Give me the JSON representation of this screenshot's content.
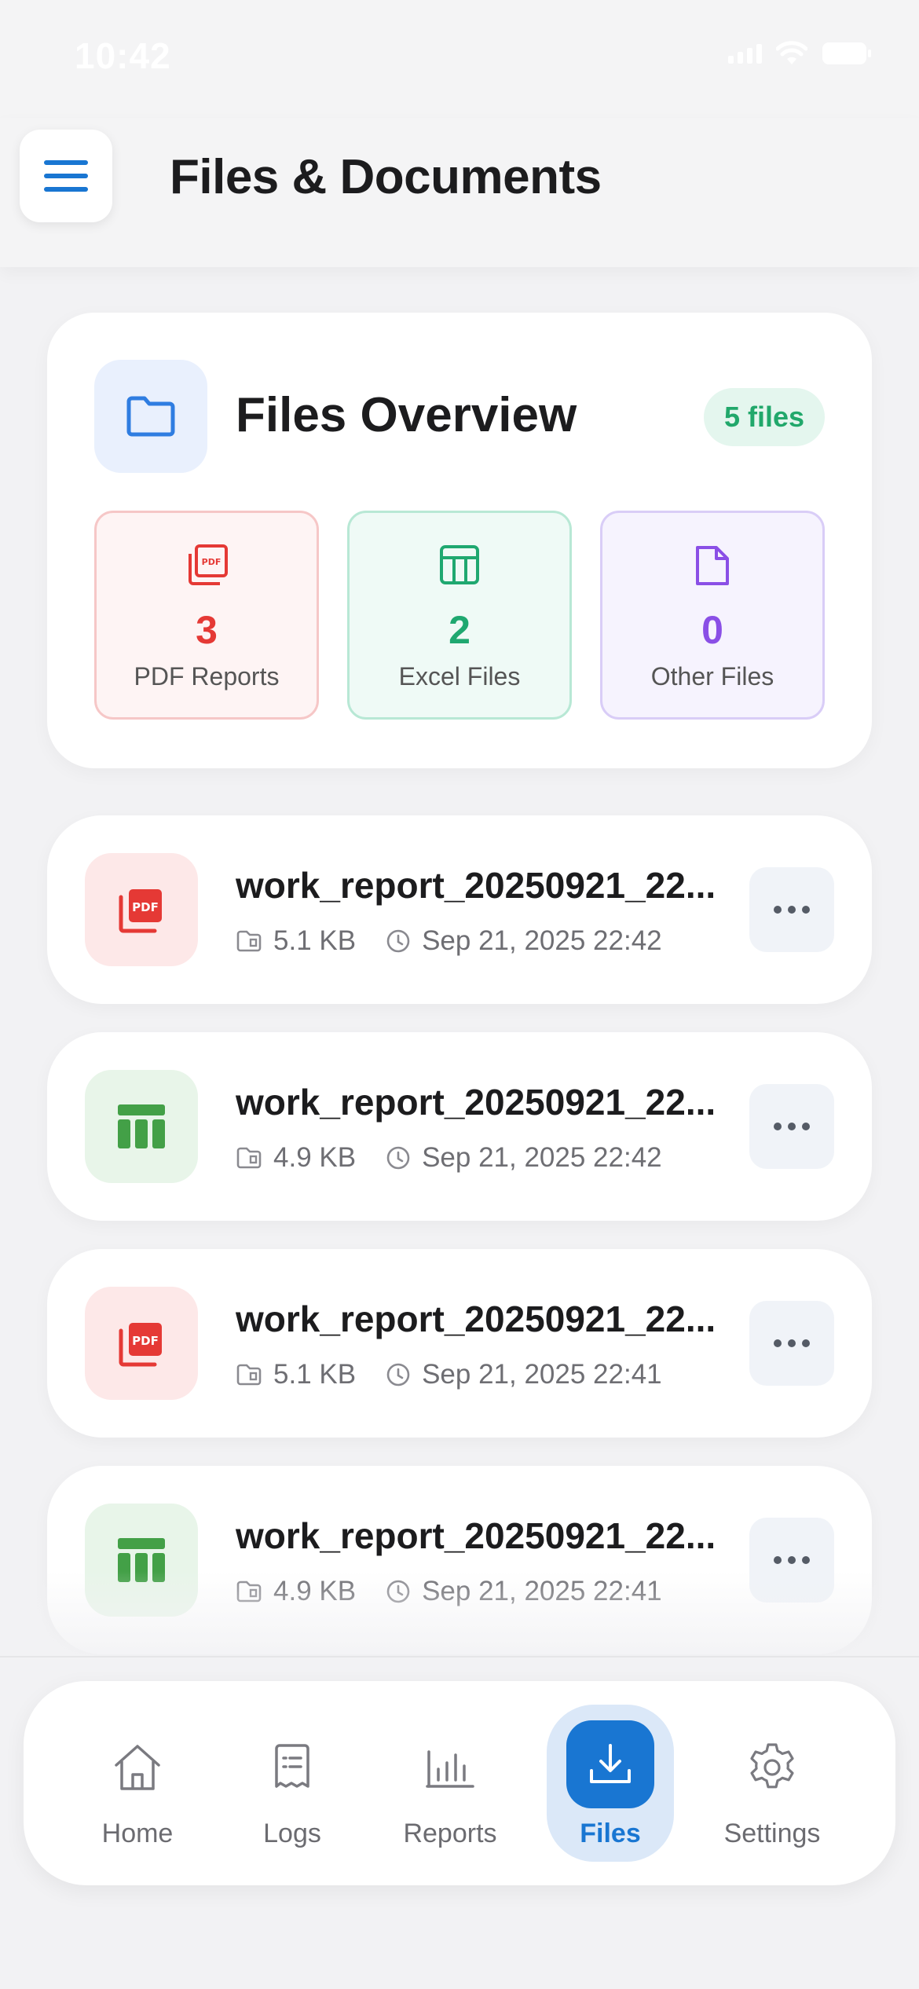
{
  "status_bar": {
    "time": "10:42"
  },
  "header": {
    "title": "Files & Documents"
  },
  "overview": {
    "title": "Files Overview",
    "badge": "5 files",
    "stats": [
      {
        "type": "pdf",
        "count": "3",
        "label": "PDF Reports",
        "color": "#e53935"
      },
      {
        "type": "excel",
        "count": "2",
        "label": "Excel Files",
        "color": "#1fa870"
      },
      {
        "type": "other",
        "count": "0",
        "label": "Other Files",
        "color": "#8a4fe6"
      }
    ]
  },
  "files": [
    {
      "type": "pdf",
      "name": "work_report_20250921_22...",
      "size": "5.1 KB",
      "date": "Sep 21, 2025 22:42"
    },
    {
      "type": "excel",
      "name": "work_report_20250921_22...",
      "size": "4.9 KB",
      "date": "Sep 21, 2025 22:42"
    },
    {
      "type": "pdf",
      "name": "work_report_20250921_22...",
      "size": "5.1 KB",
      "date": "Sep 21, 2025 22:41"
    },
    {
      "type": "excel",
      "name": "work_report_20250921_22...",
      "size": "4.9 KB",
      "date": "Sep 21, 2025 22:41"
    }
  ],
  "nav": {
    "items": [
      {
        "label": "Home",
        "icon": "home-icon"
      },
      {
        "label": "Logs",
        "icon": "logs-icon"
      },
      {
        "label": "Reports",
        "icon": "reports-icon"
      },
      {
        "label": "Files",
        "icon": "download-icon",
        "active": true
      },
      {
        "label": "Settings",
        "icon": "gear-icon"
      }
    ]
  },
  "colors": {
    "accent": "#1976d2",
    "pdf": "#e53935",
    "excel": "#43a047",
    "other": "#8a4fe6"
  }
}
